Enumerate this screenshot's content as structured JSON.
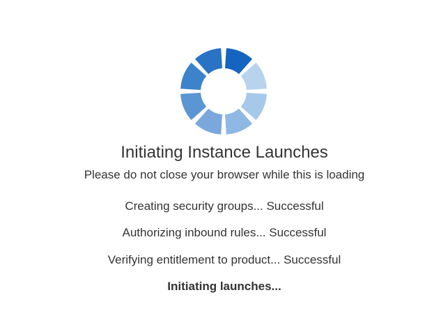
{
  "spinner": {
    "icon": "loading-spinner-icon",
    "segment_colors": [
      "#1565c0",
      "#b7d3ee",
      "#a6c8ea",
      "#8fb8e4",
      "#7aa8dc",
      "#5b95d2",
      "#3d83cb",
      "#2a72c4"
    ]
  },
  "loading": {
    "title": "Initiating Instance Launches",
    "subtitle": "Please do not close your browser while this is loading"
  },
  "steps": [
    {
      "text": "Creating security groups... Successful"
    },
    {
      "text": "Authorizing inbound rules... Successful"
    },
    {
      "text": "Verifying entitlement to product... Successful"
    },
    {
      "text": "Initiating launches..."
    }
  ]
}
